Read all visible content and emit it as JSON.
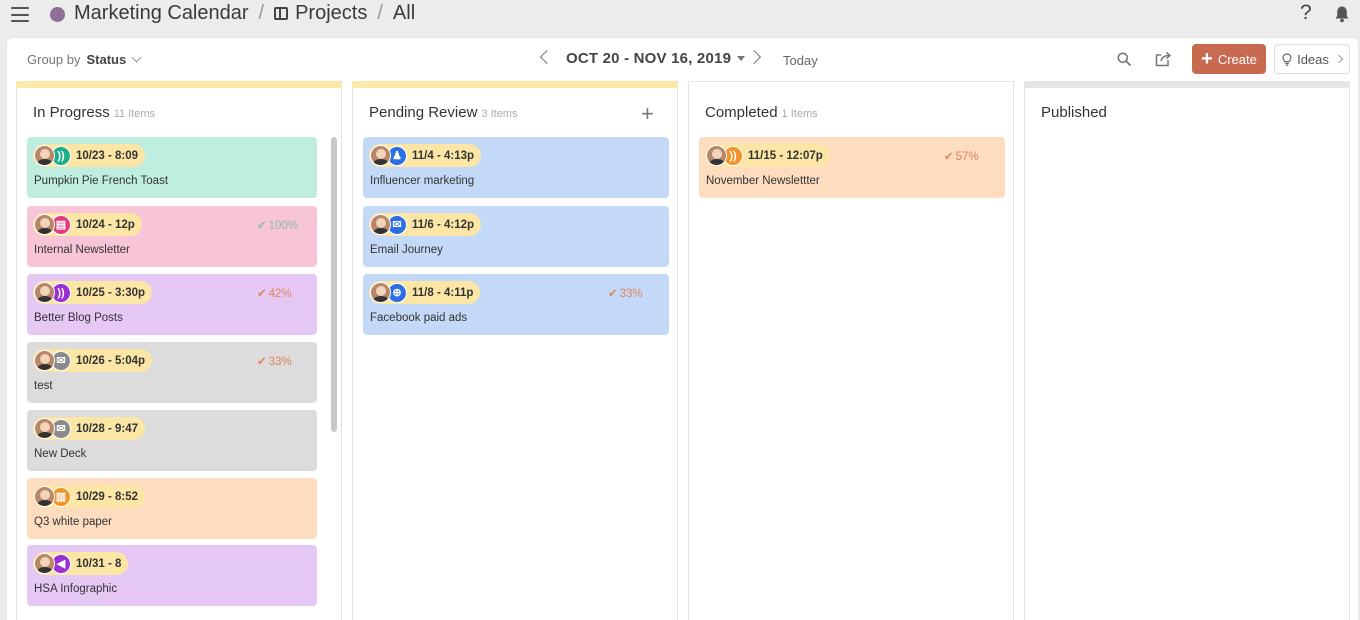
{
  "breadcrumb": {
    "calendar": "Marketing Calendar",
    "sep1": "/",
    "projects": "Projects",
    "sep2": "/",
    "view": "All"
  },
  "help_label": "?",
  "toolbar": {
    "group_by_label": "Group by",
    "group_by_value": "Status",
    "date_range": "OCT 20 - NOV 16, 2019",
    "today_label": "Today",
    "create_label": "Create",
    "ideas_label": "Ideas"
  },
  "colors": {
    "calendar_dot": "#8e6f98",
    "create_button": "#c86a50",
    "in_progress_bar": "#fce9a7",
    "pending_review_bar": "#fce9a7",
    "completed_bar": "#e6e6e6",
    "published_bar": "#e6e6e6"
  },
  "columns": [
    {
      "title": "In Progress",
      "count": "11 Items",
      "cards": [
        {
          "time": "10/23 - 8:09",
          "title": "Pumpkin Pie French Toast",
          "percent": "",
          "color": "#bfeee0",
          "channel_icon": "rss-icon",
          "channel_color": "#1fb08a"
        },
        {
          "time": "10/24 - 12p",
          "title": "Internal Newsletter",
          "percent": "100%",
          "color": "#f8c4d8",
          "channel_icon": "newsletter-icon",
          "channel_color": "#e63b7a"
        },
        {
          "time": "10/25 - 3:30p",
          "title": "Better Blog Posts",
          "percent": "42%",
          "color": "#e6c8f5",
          "channel_icon": "rss-icon",
          "channel_color": "#9b2fd1"
        },
        {
          "time": "10/26 - 5:04p",
          "title": "test",
          "percent": "33%",
          "color": "#dcdcdc",
          "channel_icon": "email-icon",
          "channel_color": "#8a8a8a"
        },
        {
          "time": "10/28 - 9:47",
          "title": "New Deck",
          "percent": "",
          "color": "#dcdcdc",
          "channel_icon": "email-icon",
          "channel_color": "#8a8a8a"
        },
        {
          "time": "10/29 - 8:52",
          "title": "Q3 white paper",
          "percent": "",
          "color": "#fddcc0",
          "channel_icon": "map-icon",
          "channel_color": "#f39328"
        },
        {
          "time": "10/31 - 8",
          "title": "HSA Infographic",
          "percent": "",
          "color": "#e6c8f5",
          "channel_icon": "megaphone-icon",
          "channel_color": "#9b2fd1"
        }
      ]
    },
    {
      "title": "Pending Review",
      "count": "3 Items",
      "add_label": "+",
      "cards": [
        {
          "time": "11/4 - 4:13p",
          "title": "Influencer marketing",
          "percent": "",
          "color": "#c3d9f7",
          "channel_icon": "person-icon",
          "channel_color": "#2b6fe3"
        },
        {
          "time": "11/6 - 4:12p",
          "title": "Email Journey",
          "percent": "",
          "color": "#c3d9f7",
          "channel_icon": "email-icon",
          "channel_color": "#2b6fe3"
        },
        {
          "time": "11/8 - 4:11p",
          "title": "Facebook paid ads",
          "percent": "33%",
          "color": "#c3d9f7",
          "channel_icon": "target-icon",
          "channel_color": "#2b6fe3"
        }
      ]
    },
    {
      "title": "Completed",
      "count": "1 Items",
      "cards": [
        {
          "time": "11/15 - 12:07p",
          "title": "November Newslettter",
          "percent": "57%",
          "color": "#fddcc0",
          "channel_icon": "rss-icon",
          "channel_color": "#f39328"
        }
      ]
    },
    {
      "title": "Published",
      "count": "",
      "cards": []
    }
  ]
}
